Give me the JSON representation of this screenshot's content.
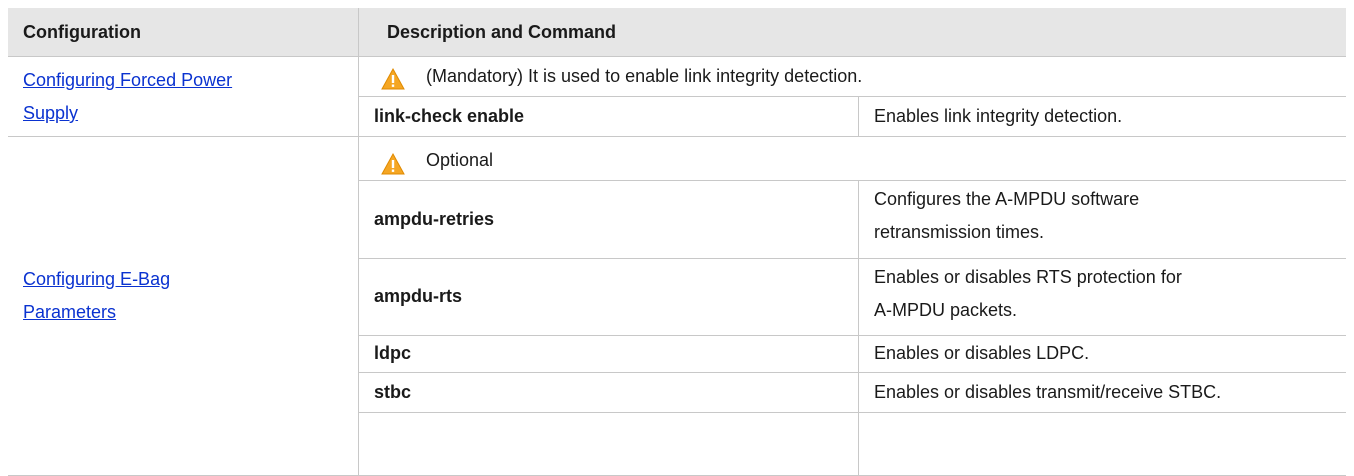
{
  "header": {
    "col1": "Configuration",
    "col2": "Description and Command"
  },
  "rows": [
    {
      "config_link_line1": "Configuring Forced Power",
      "config_link_line2": "Supply",
      "note": "(Mandatory) It is used to enable link integrity detection.",
      "commands": [
        {
          "command": "link-check enable",
          "description": "Enables link integrity detection."
        }
      ]
    },
    {
      "config_link_line1": "Configuring E-Bag",
      "config_link_line2": "Parameters",
      "note": "Optional",
      "commands": [
        {
          "command": "ampdu-retries",
          "description_line1": "Configures the A-MPDU software",
          "description_line2": "retransmission times."
        },
        {
          "command": "ampdu-rts",
          "description_line1": "Enables or disables RTS protection for",
          "description_line2": "A-MPDU packets."
        },
        {
          "command": "ldpc",
          "description": "Enables or disables LDPC."
        },
        {
          "command": "stbc",
          "description": "Enables or disables transmit/receive STBC."
        }
      ]
    }
  ],
  "icons": {
    "warning": "warning-triangle-icon",
    "warning_color": "#f5a623"
  }
}
